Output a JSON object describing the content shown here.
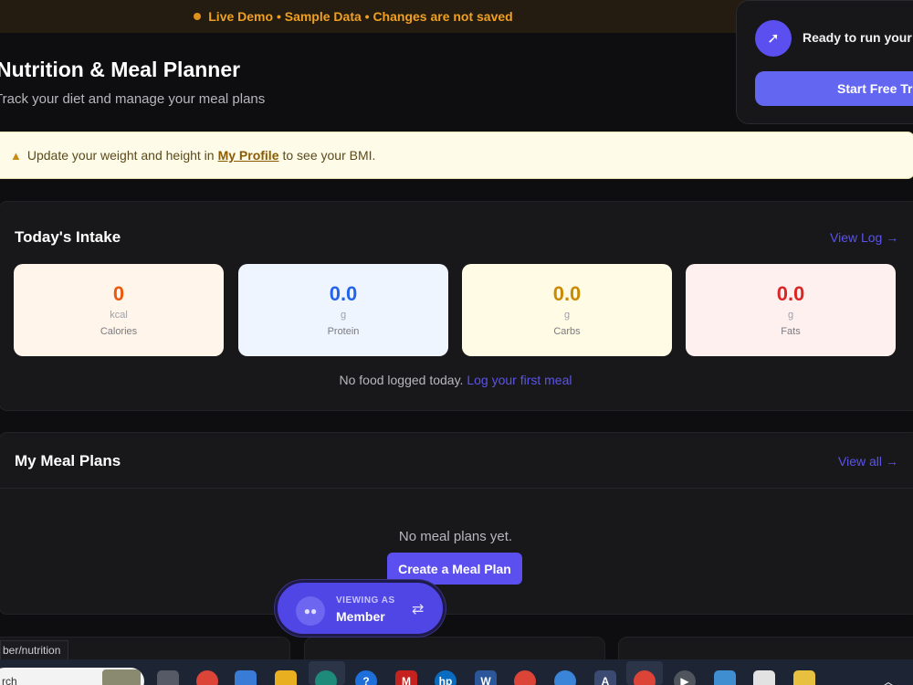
{
  "banner": {
    "text": "Live Demo • Sample Data • Changes are not saved",
    "color": "#f0a020"
  },
  "header": {
    "title": "Nutrition & Meal Planner",
    "subtitle": "Track your diet and manage your meal plans"
  },
  "trial": {
    "text": "Ready to run your",
    "button": "Start Free Tri",
    "icon": "rocket-icon"
  },
  "warning": {
    "prefix": "Update your weight and height in",
    "link": "My Profile",
    "suffix": "to see your BMI.",
    "icon": "warning-icon"
  },
  "intake": {
    "title": "Today's Intake",
    "view_link": "View Log →",
    "stats": [
      {
        "value": "0",
        "unit": "kcal",
        "label": "Calories",
        "color": "#ea580c"
      },
      {
        "value": "0.0",
        "unit": "g",
        "label": "Protein",
        "color": "#2563eb"
      },
      {
        "value": "0.0",
        "unit": "g",
        "label": "Carbs",
        "color": "#ca8a04"
      },
      {
        "value": "0.0",
        "unit": "g",
        "label": "Fats",
        "color": "#dc2626"
      }
    ],
    "empty_text": "No food logged today.",
    "empty_link": "Log your first meal"
  },
  "plans": {
    "title": "My Meal Plans",
    "view_link": "View all →",
    "empty_text": "No meal plans yet.",
    "create_button": "Create a Meal Plan"
  },
  "viewing": {
    "line1": "VIEWING AS",
    "line2": "Member",
    "swap_icon": "swap-icon"
  },
  "status_url": "ber/nutrition",
  "taskbar": {
    "search_text": "rch",
    "icons": [
      "windows-icon",
      "chrome-icon",
      "store-icon",
      "folder-icon",
      "edge-icon",
      "help-icon",
      "gmail-icon",
      "hp-icon",
      "word-icon",
      "chrome-icon",
      "sync-icon",
      "arc-icon",
      "chrome-icon",
      "media-icon",
      "edit-icon",
      "snip-icon",
      "file-icon"
    ]
  },
  "accent": "#6366f1"
}
